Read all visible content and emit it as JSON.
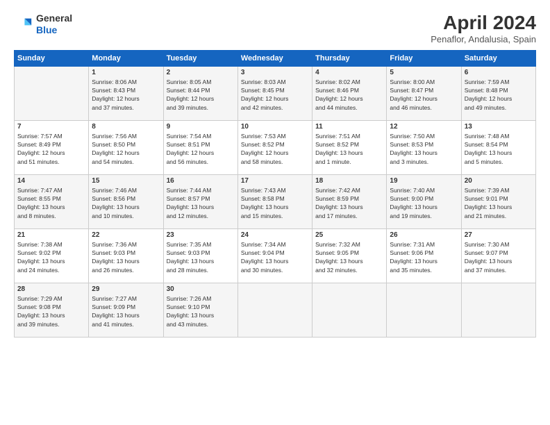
{
  "header": {
    "logo_general": "General",
    "logo_blue": "Blue",
    "month_title": "April 2024",
    "subtitle": "Penaflor, Andalusia, Spain"
  },
  "days_of_week": [
    "Sunday",
    "Monday",
    "Tuesday",
    "Wednesday",
    "Thursday",
    "Friday",
    "Saturday"
  ],
  "weeks": [
    [
      {
        "day": "",
        "info": ""
      },
      {
        "day": "1",
        "info": "Sunrise: 8:06 AM\nSunset: 8:43 PM\nDaylight: 12 hours\nand 37 minutes."
      },
      {
        "day": "2",
        "info": "Sunrise: 8:05 AM\nSunset: 8:44 PM\nDaylight: 12 hours\nand 39 minutes."
      },
      {
        "day": "3",
        "info": "Sunrise: 8:03 AM\nSunset: 8:45 PM\nDaylight: 12 hours\nand 42 minutes."
      },
      {
        "day": "4",
        "info": "Sunrise: 8:02 AM\nSunset: 8:46 PM\nDaylight: 12 hours\nand 44 minutes."
      },
      {
        "day": "5",
        "info": "Sunrise: 8:00 AM\nSunset: 8:47 PM\nDaylight: 12 hours\nand 46 minutes."
      },
      {
        "day": "6",
        "info": "Sunrise: 7:59 AM\nSunset: 8:48 PM\nDaylight: 12 hours\nand 49 minutes."
      }
    ],
    [
      {
        "day": "7",
        "info": "Sunrise: 7:57 AM\nSunset: 8:49 PM\nDaylight: 12 hours\nand 51 minutes."
      },
      {
        "day": "8",
        "info": "Sunrise: 7:56 AM\nSunset: 8:50 PM\nDaylight: 12 hours\nand 54 minutes."
      },
      {
        "day": "9",
        "info": "Sunrise: 7:54 AM\nSunset: 8:51 PM\nDaylight: 12 hours\nand 56 minutes."
      },
      {
        "day": "10",
        "info": "Sunrise: 7:53 AM\nSunset: 8:52 PM\nDaylight: 12 hours\nand 58 minutes."
      },
      {
        "day": "11",
        "info": "Sunrise: 7:51 AM\nSunset: 8:52 PM\nDaylight: 13 hours\nand 1 minute."
      },
      {
        "day": "12",
        "info": "Sunrise: 7:50 AM\nSunset: 8:53 PM\nDaylight: 13 hours\nand 3 minutes."
      },
      {
        "day": "13",
        "info": "Sunrise: 7:48 AM\nSunset: 8:54 PM\nDaylight: 13 hours\nand 5 minutes."
      }
    ],
    [
      {
        "day": "14",
        "info": "Sunrise: 7:47 AM\nSunset: 8:55 PM\nDaylight: 13 hours\nand 8 minutes."
      },
      {
        "day": "15",
        "info": "Sunrise: 7:46 AM\nSunset: 8:56 PM\nDaylight: 13 hours\nand 10 minutes."
      },
      {
        "day": "16",
        "info": "Sunrise: 7:44 AM\nSunset: 8:57 PM\nDaylight: 13 hours\nand 12 minutes."
      },
      {
        "day": "17",
        "info": "Sunrise: 7:43 AM\nSunset: 8:58 PM\nDaylight: 13 hours\nand 15 minutes."
      },
      {
        "day": "18",
        "info": "Sunrise: 7:42 AM\nSunset: 8:59 PM\nDaylight: 13 hours\nand 17 minutes."
      },
      {
        "day": "19",
        "info": "Sunrise: 7:40 AM\nSunset: 9:00 PM\nDaylight: 13 hours\nand 19 minutes."
      },
      {
        "day": "20",
        "info": "Sunrise: 7:39 AM\nSunset: 9:01 PM\nDaylight: 13 hours\nand 21 minutes."
      }
    ],
    [
      {
        "day": "21",
        "info": "Sunrise: 7:38 AM\nSunset: 9:02 PM\nDaylight: 13 hours\nand 24 minutes."
      },
      {
        "day": "22",
        "info": "Sunrise: 7:36 AM\nSunset: 9:03 PM\nDaylight: 13 hours\nand 26 minutes."
      },
      {
        "day": "23",
        "info": "Sunrise: 7:35 AM\nSunset: 9:03 PM\nDaylight: 13 hours\nand 28 minutes."
      },
      {
        "day": "24",
        "info": "Sunrise: 7:34 AM\nSunset: 9:04 PM\nDaylight: 13 hours\nand 30 minutes."
      },
      {
        "day": "25",
        "info": "Sunrise: 7:32 AM\nSunset: 9:05 PM\nDaylight: 13 hours\nand 32 minutes."
      },
      {
        "day": "26",
        "info": "Sunrise: 7:31 AM\nSunset: 9:06 PM\nDaylight: 13 hours\nand 35 minutes."
      },
      {
        "day": "27",
        "info": "Sunrise: 7:30 AM\nSunset: 9:07 PM\nDaylight: 13 hours\nand 37 minutes."
      }
    ],
    [
      {
        "day": "28",
        "info": "Sunrise: 7:29 AM\nSunset: 9:08 PM\nDaylight: 13 hours\nand 39 minutes."
      },
      {
        "day": "29",
        "info": "Sunrise: 7:27 AM\nSunset: 9:09 PM\nDaylight: 13 hours\nand 41 minutes."
      },
      {
        "day": "30",
        "info": "Sunrise: 7:26 AM\nSunset: 9:10 PM\nDaylight: 13 hours\nand 43 minutes."
      },
      {
        "day": "",
        "info": ""
      },
      {
        "day": "",
        "info": ""
      },
      {
        "day": "",
        "info": ""
      },
      {
        "day": "",
        "info": ""
      }
    ]
  ]
}
